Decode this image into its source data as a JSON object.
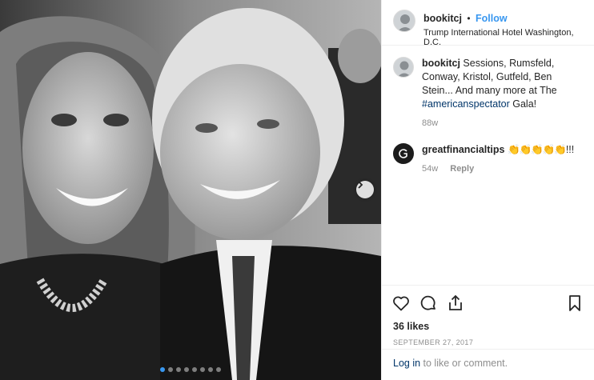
{
  "post": {
    "username": "bookitcj",
    "separator": "•",
    "follow_label": "Follow",
    "location": "Trump International Hotel Washington, D.C.",
    "photo_icon": "next-arrow-icon",
    "carousel_count": 8
  },
  "caption": {
    "username": "bookitcj",
    "text_before": "Sessions, Rumsfeld, Conway, Kristol, Gutfeld, Ben Stein... And many more at The ",
    "hashtag": "#americanspectator",
    "text_after": " Gala!",
    "age": "88w"
  },
  "comment": {
    "username": "greatfinancialtips",
    "emoji": "👏👏👏👏👏",
    "text": "!!!",
    "age": "54w",
    "reply_label": "Reply"
  },
  "actions": {
    "icons": [
      "heart-icon",
      "comment-icon",
      "share-icon",
      "bookmark-icon"
    ],
    "likes": "36 likes",
    "date": "SEPTEMBER 27, 2017"
  },
  "footer": {
    "login_label": "Log in",
    "rest": " to like or comment."
  },
  "colors": {
    "accent": "#3897f0",
    "link": "#003569",
    "muted": "#8e8e8e",
    "border": "#efefef"
  }
}
